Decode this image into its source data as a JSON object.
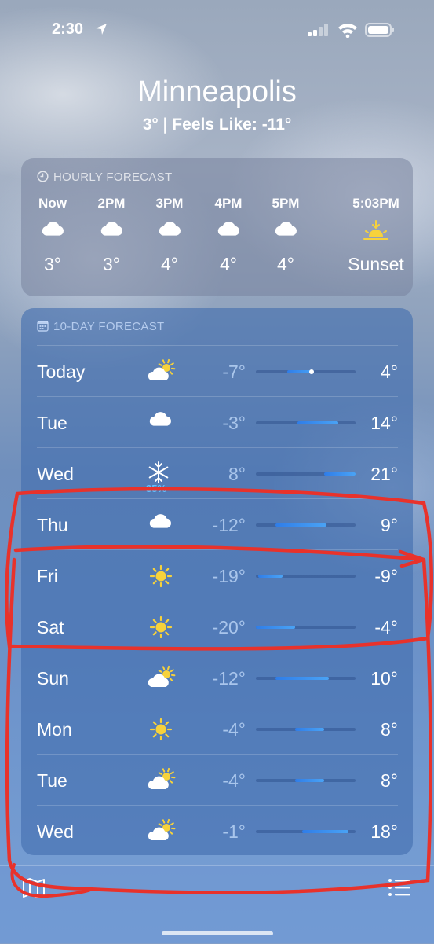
{
  "status": {
    "time": "2:30",
    "icons": [
      "location-arrow-icon",
      "signal-icon",
      "wifi-icon",
      "battery-icon"
    ]
  },
  "header": {
    "city": "Minneapolis",
    "subtitle": "3°  |  Feels Like: -11°"
  },
  "hourly": {
    "title": "HOURLY FORECAST",
    "items": [
      {
        "time": "Now",
        "icon": "cloud-icon",
        "temp": "3°"
      },
      {
        "time": "2PM",
        "icon": "cloud-icon",
        "temp": "3°"
      },
      {
        "time": "3PM",
        "icon": "cloud-icon",
        "temp": "4°"
      },
      {
        "time": "4PM",
        "icon": "cloud-icon",
        "temp": "4°"
      },
      {
        "time": "5PM",
        "icon": "cloud-icon",
        "temp": "4°"
      },
      {
        "time": "5:03PM",
        "icon": "sunset-icon",
        "temp": "Sunset"
      }
    ]
  },
  "daily": {
    "title": "10-DAY FORECAST",
    "range_bar_extent": [
      -20,
      21
    ],
    "current_temp": 3,
    "days": [
      {
        "day": "Today",
        "icon": "partly-cloudy-icon",
        "low": "-7°",
        "high": "4°",
        "low_value": -7,
        "high_value": 4
      },
      {
        "day": "Tue",
        "icon": "cloud-icon",
        "low": "-3°",
        "high": "14°",
        "low_value": -3,
        "high_value": 14
      },
      {
        "day": "Wed",
        "icon": "snow-icon",
        "precip": "35%",
        "low": "8°",
        "high": "21°",
        "low_value": 8,
        "high_value": 21
      },
      {
        "day": "Thu",
        "icon": "cloud-icon",
        "low": "-12°",
        "high": "9°",
        "low_value": -12,
        "high_value": 9
      },
      {
        "day": "Fri",
        "icon": "sun-icon",
        "low": "-19°",
        "high": "-9°",
        "low_value": -19,
        "high_value": -9
      },
      {
        "day": "Sat",
        "icon": "sun-icon",
        "low": "-20°",
        "high": "-4°",
        "low_value": -20,
        "high_value": -4
      },
      {
        "day": "Sun",
        "icon": "partly-cloudy-icon",
        "low": "-12°",
        "high": "10°",
        "low_value": -12,
        "high_value": 10
      },
      {
        "day": "Mon",
        "icon": "sun-icon",
        "low": "-4°",
        "high": "8°",
        "low_value": -4,
        "high_value": 8
      },
      {
        "day": "Tue",
        "icon": "partly-cloudy-icon",
        "low": "-4°",
        "high": "8°",
        "low_value": -4,
        "high_value": 8
      },
      {
        "day": "Wed",
        "icon": "partly-cloudy-icon",
        "low": "-1°",
        "high": "18°",
        "low_value": -1,
        "high_value": 18
      }
    ]
  },
  "bottom": {
    "icons": [
      "map-icon",
      "list-icon"
    ]
  },
  "annotation": {
    "color": "#e8322b"
  }
}
